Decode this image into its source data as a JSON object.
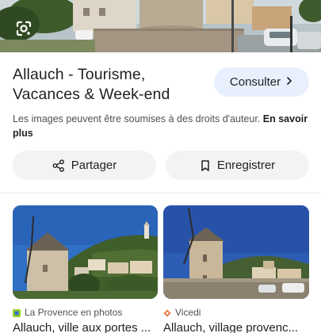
{
  "result": {
    "title": "Allauch - Tourisme, Vacances & Week-end",
    "consult_label": "Consulter",
    "notice_text": "Les images peuvent être soumises à des droits d'auteur.",
    "learn_more_label": "En savoir plus"
  },
  "actions": {
    "share_label": "Partager",
    "save_label": "Enregistrer"
  },
  "related": [
    {
      "source": "La Provence en photos",
      "caption": "Allauch, ville aux portes ..."
    },
    {
      "source": "Vicedi",
      "caption": "Allauch, village provenc..."
    }
  ],
  "colors": {
    "consult_bg": "#e8f0fe",
    "pill_bg": "#f1f3f4",
    "source1_icon": "#9bd12b",
    "source2_icon": "#e8743b"
  },
  "icons": [
    "google-lens-icon",
    "chevron-right-icon",
    "share-icon",
    "bookmark-icon"
  ]
}
